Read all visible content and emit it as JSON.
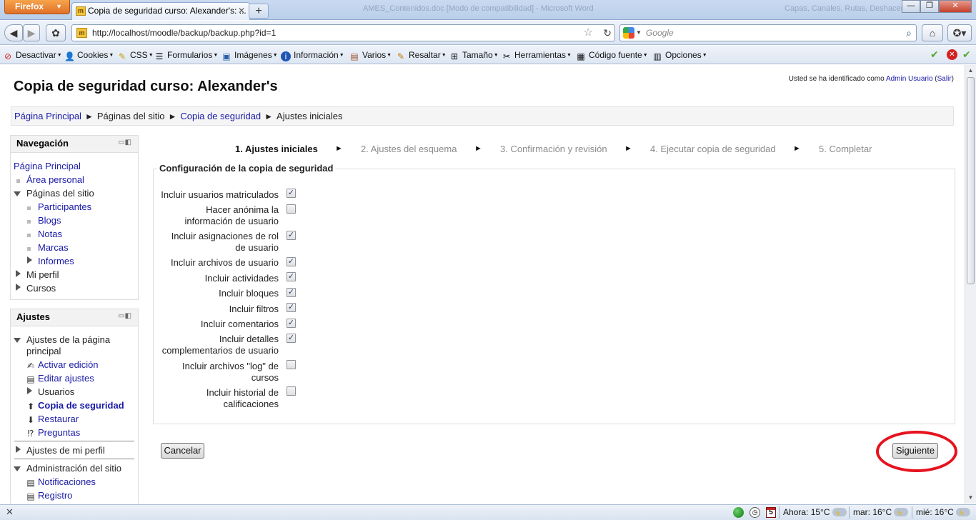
{
  "browser": {
    "app_button": "Firefox",
    "tab_title": "Copia de seguridad curso: Alexander's: ...",
    "faded_window_titles": [
      "AMES_Contenidos.doc [Modo de compatibilidad] - Microsoft Word",
      "Capas, Canales, Rutas, Deshacer..."
    ],
    "url": "http://localhost/moodle/backup/backup.php?id=1",
    "search_placeholder": "Google",
    "win_min": "—",
    "win_max": "❐",
    "win_close": "✕",
    "newtab": "+"
  },
  "devtoolbar": {
    "items": [
      "Desactivar",
      "Cookies",
      "CSS",
      "Formularios",
      "Imágenes",
      "Información",
      "Varios",
      "Resaltar",
      "Tamaño",
      "Herramientas",
      "Código fuente",
      "Opciones"
    ]
  },
  "page": {
    "title": "Copia de seguridad curso: Alexander's",
    "login": {
      "prefix": "Usted se ha identificado como ",
      "user": "Admin Usuario",
      "logout": "Salir"
    },
    "breadcrumb": [
      "Página Principal",
      "Páginas del sitio",
      "Copia de seguridad",
      "Ajustes iniciales"
    ],
    "breadcrumb_sep": "►"
  },
  "navigation": {
    "title": "Navegación",
    "home": "Página Principal",
    "area_personal": "Área personal",
    "site_pages": "Páginas del sitio",
    "participantes": "Participantes",
    "blogs": "Blogs",
    "notas": "Notas",
    "marcas": "Marcas",
    "informes": "Informes",
    "mi_perfil": "Mi perfil",
    "cursos": "Cursos"
  },
  "settings": {
    "title": "Ajustes",
    "front_page": "Ajustes de la página principal",
    "activar": "Activar edición",
    "editar": "Editar ajustes",
    "usuarios": "Usuarios",
    "copia": "Copia de seguridad",
    "restaurar": "Restaurar",
    "preguntas": "Preguntas",
    "mi_perfil": "Ajustes de mi perfil",
    "admin": "Administración del sitio",
    "notificaciones": "Notificaciones",
    "registro": "Registro"
  },
  "steps": [
    "1. Ajustes iniciales",
    "2. Ajustes del esquema",
    "3. Confirmación y revisión",
    "4. Ejecutar copia de seguridad",
    "5. Completar"
  ],
  "step_arrow": "►",
  "form": {
    "legend": "Configuración de la copia de seguridad",
    "options": [
      {
        "label": "Incluir usuarios matriculados",
        "checked": true
      },
      {
        "label": "Hacer anónima la información de usuario",
        "checked": false
      },
      {
        "label": "Incluir asignaciones de rol de usuario",
        "checked": true
      },
      {
        "label": "Incluir archivos de usuario",
        "checked": true
      },
      {
        "label": "Incluir actividades",
        "checked": true
      },
      {
        "label": "Incluir bloques",
        "checked": true
      },
      {
        "label": "Incluir filtros",
        "checked": true
      },
      {
        "label": "Incluir comentarios",
        "checked": true
      },
      {
        "label": "Incluir detalles complementarios de usuario",
        "checked": true
      },
      {
        "label": "Incluir archivos \"log\" de cursos",
        "checked": false
      },
      {
        "label": "Incluir historial de calificaciones",
        "checked": false
      }
    ],
    "cancel": "Cancelar",
    "next": "Siguiente"
  },
  "statusbar": {
    "close": "✕",
    "calendar_day": "5",
    "weather_now": "Ahora: 15°C",
    "weather_tue": "mar: 16°C",
    "weather_wed": "mié: 16°C"
  },
  "colors": {
    "link": "#1a1aa8",
    "highlight_ellipse": "#e6121e",
    "firefox_orange": "#e0702a"
  }
}
